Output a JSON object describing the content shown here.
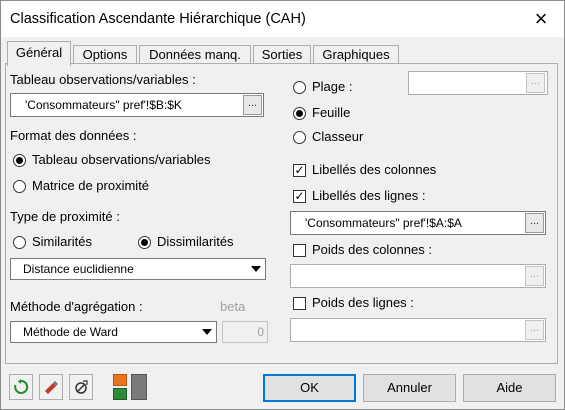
{
  "window": {
    "title": "Classification Ascendante Hiérarchique (CAH)",
    "close_icon": "×"
  },
  "tabs": [
    {
      "label": "Général",
      "active": true
    },
    {
      "label": "Options"
    },
    {
      "label": "Données manq."
    },
    {
      "label": "Sorties"
    },
    {
      "label": "Graphiques"
    }
  ],
  "left": {
    "table_label": "Tableau observations/variables :",
    "table_value": "'Consommateurs\" pref'!$B:$K",
    "format_label": "Format des données :",
    "format_options": [
      "Tableau observations/variables",
      "Matrice de proximité"
    ],
    "format_selected": "Tableau observations/variables",
    "proximity_type_label": "Type de proximité :",
    "proximity_options": [
      "Similarités",
      "Dissimilarités"
    ],
    "proximity_selected": "Dissimilarités",
    "distance_value": "Distance euclidienne",
    "aggregation_label": "Méthode d'agrégation :",
    "beta_label": "beta",
    "aggregation_value": "Méthode de Ward",
    "beta_value": "0"
  },
  "right": {
    "range_options": [
      "Plage :",
      "Feuille",
      "Classeur"
    ],
    "range_selected": "Feuille",
    "plage_value": "",
    "col_labels": {
      "label": "Libellés des colonnes",
      "checked": true
    },
    "row_labels": {
      "label": "Libellés des lignes :",
      "checked": true
    },
    "row_labels_value": "'Consommateurs\" pref'!$A:$A",
    "col_weights": {
      "label": "Poids des colonnes :",
      "checked": false
    },
    "row_weights": {
      "label": "Poids des lignes :",
      "checked": false
    }
  },
  "buttons": {
    "ok": "OK",
    "cancel": "Annuler",
    "help": "Aide",
    "browse_dots": "..."
  },
  "icons": [
    "reset-icon",
    "eraser-icon",
    "options-icon",
    "color-icon"
  ],
  "colors": {
    "accent": "#0078d7",
    "reset_green": "#1e8a2e",
    "eraser_red": "#c0392b",
    "orange": "#e8741c",
    "green": "#2e8b3a"
  }
}
